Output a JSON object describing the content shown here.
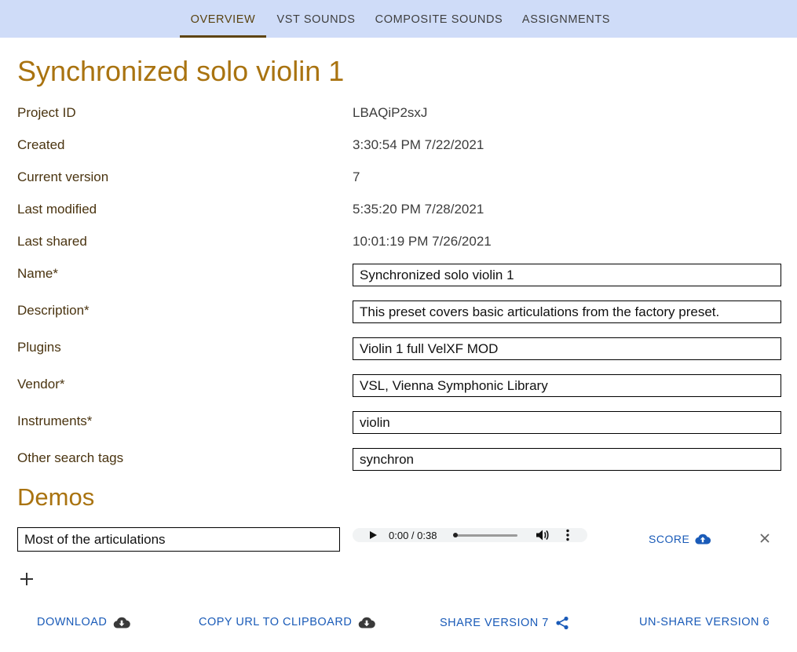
{
  "nav": {
    "tabs": [
      {
        "label": "OVERVIEW",
        "active": true
      },
      {
        "label": "VST SOUNDS",
        "active": false
      },
      {
        "label": "COMPOSITE SOUNDS",
        "active": false
      },
      {
        "label": "ASSIGNMENTS",
        "active": false
      }
    ]
  },
  "page_title": "Synchronized solo violin 1",
  "info": {
    "project_id": {
      "label": "Project ID",
      "value": "LBAQiP2sxJ"
    },
    "created": {
      "label": "Created",
      "value": "3:30:54 PM 7/22/2021"
    },
    "current_version": {
      "label": "Current version",
      "value": "7"
    },
    "last_modified": {
      "label": "Last modified",
      "value": "5:35:20 PM 7/28/2021"
    },
    "last_shared": {
      "label": "Last shared",
      "value": "10:01:19 PM 7/26/2021"
    }
  },
  "form": {
    "name": {
      "label": "Name*",
      "value": "Synchronized solo violin 1"
    },
    "description": {
      "label": "Description*",
      "value": "This preset covers basic articulations from the factory preset."
    },
    "plugins": {
      "label": "Plugins",
      "value": "Violin 1 full VelXF MOD"
    },
    "vendor": {
      "label": "Vendor*",
      "value": "VSL, Vienna Symphonic Library"
    },
    "instruments": {
      "label": "Instruments*",
      "value": "violin"
    },
    "tags": {
      "label": "Other search tags",
      "value": "synchron"
    }
  },
  "demos": {
    "title": "Demos",
    "items": [
      {
        "name": "Most of the articulations",
        "time": "0:00 / 0:38",
        "progress": 0.0,
        "score_label": "SCORE"
      }
    ]
  },
  "actions": {
    "download": "DOWNLOAD",
    "copy_url": "COPY URL TO CLIPBOARD",
    "share": "SHARE VERSION 7",
    "unshare": "UN-SHARE VERSION 6"
  },
  "colors": {
    "nav_bg": "#cfdcf8",
    "title": "#a97310",
    "label": "#4a3410",
    "link": "#1a5bb8"
  },
  "icons": {
    "score": "cloud-upload-icon",
    "download": "cloud-download-icon",
    "copy_url": "cloud-download-icon",
    "share": "share-icon",
    "close": "close-icon",
    "add": "plus-icon"
  }
}
